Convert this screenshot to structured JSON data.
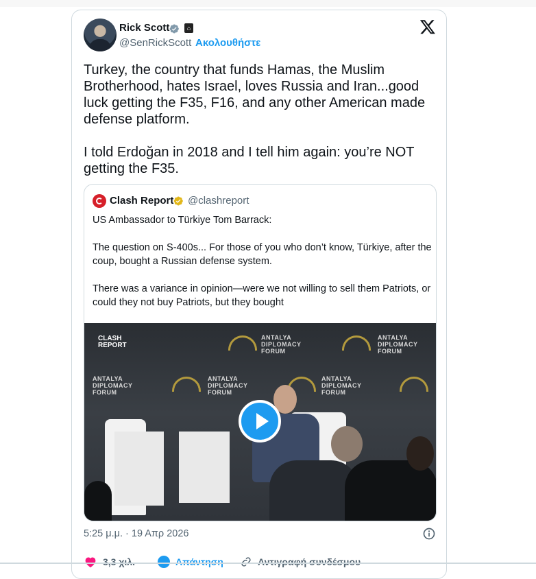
{
  "author": {
    "name": "Rick Scott",
    "handle": "@SenRickScott",
    "separator": "·",
    "follow_label": "Ακολουθήστε",
    "flag_glyph": "⌂"
  },
  "tweet": {
    "text": "Turkey, the country that funds Hamas, the Muslim Brotherhood, hates Israel, loves Russia and Iran...good luck getting the F35, F16, and any other American made defense platform.\n\nI told Erdoğan in 2018 and I tell him again: you’re NOT getting the F35.",
    "timestamp": "5:25 μ.μ. · 19 Απρ 2026"
  },
  "quote": {
    "name": "Clash Report",
    "handle": "@clashreport",
    "text": "US Ambassador to Türkiye Tom Barrack:\n\nThe question on S-400s... For those of you who don’t know, Türkiye, after the coup, bought a Russian defense system.\n\nThere was a variance in opinion—were we not willing to sell them Patriots, or could they not buy Patriots, but they bought",
    "media": {
      "watermark_line1": "CLASH",
      "watermark_line2": "REPORT",
      "backdrop_line1": "ANTALYA",
      "backdrop_line2": "DIPLOMACY",
      "backdrop_line3": "FORUM"
    }
  },
  "actions": {
    "like_count": "3,3 χιλ.",
    "reply_label": "Απάντηση",
    "copy_label": "Αντιγραφή συνδέσμου"
  },
  "colors": {
    "accent": "#1d9bf0",
    "like": "#f91880",
    "gold_badge": "#e2b719",
    "clash_red": "#d6202a"
  }
}
